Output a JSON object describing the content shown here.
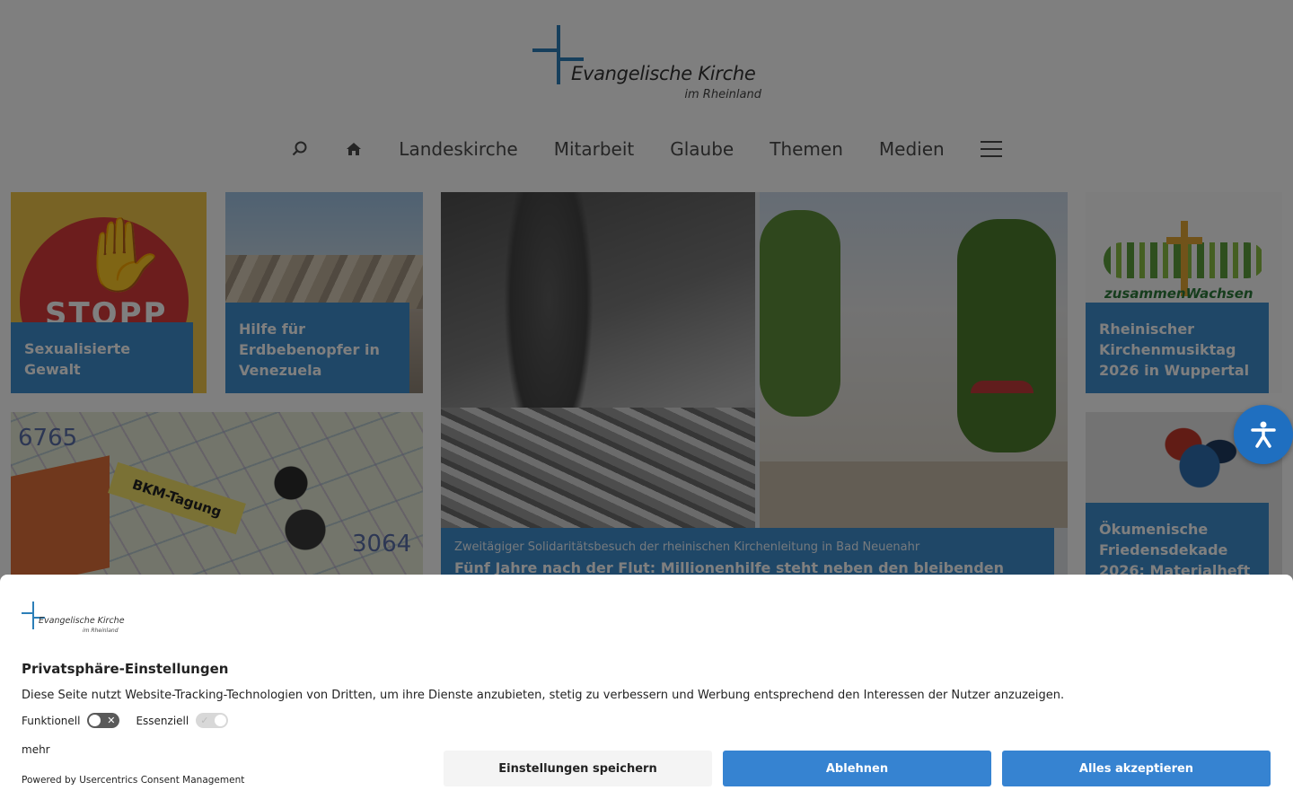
{
  "header": {
    "logo_line1": "Evangelische Kirche",
    "logo_line2": "im Rheinland"
  },
  "nav": {
    "items": [
      "Landeskirche",
      "Mitarbeit",
      "Glaube",
      "Themen",
      "Medien"
    ],
    "icons": [
      "search-icon",
      "home-icon",
      "menu-icon"
    ]
  },
  "tiles": {
    "sexualisierte": {
      "caption": "Sexualisierte Gewalt",
      "image_text": "STOPP"
    },
    "erdbeben": {
      "caption": "Hilfe für Erdbebenopfer in Venezuela"
    },
    "flut": {
      "kicker": "Zweitägiger Solidaritätsbesuch der rheinischen Kirchenleitung in Bad Neuenahr",
      "headline": "Fünf Jahre nach der Flut: Millionenhilfe steht neben den bleibenden"
    },
    "kirchenmusik": {
      "caption": "Rheinischer Kirchenmusiktag 2026 in Wuppertal",
      "image_text": "zusammenWachsen"
    },
    "bkm": {
      "image_text": "BKM-Tagung",
      "map_number_1": "6765",
      "map_number_2": "3064"
    },
    "friedensdekade": {
      "caption": "Ökumenische Friedensdekade 2026: Materialheft"
    }
  },
  "consent": {
    "logo_line1": "Evangelische Kirche",
    "logo_line2": "im Rheinland",
    "title": "Privatsphäre-Einstellungen",
    "description": "Diese Seite nutzt Website-Tracking-Technologien von Dritten, um ihre Dienste anzubieten, stetig zu verbessern und Werbung entsprechend den Interessen der Nutzer anzuzeigen.",
    "toggle_functional": "Funktionell",
    "toggle_functional_state": "off",
    "toggle_essential": "Essenziell",
    "toggle_essential_state": "on",
    "more": "mehr",
    "powered_by": "Powered by Usercentrics Consent Management",
    "btn_save": "Einstellungen speichern",
    "btn_deny": "Ablehnen",
    "btn_accept": "Alles akzeptieren"
  },
  "colors": {
    "brand_blue": "#3683d1",
    "caption_blue": "#3f8fcf",
    "overlay": "rgba(0,0,0,0.5)"
  }
}
